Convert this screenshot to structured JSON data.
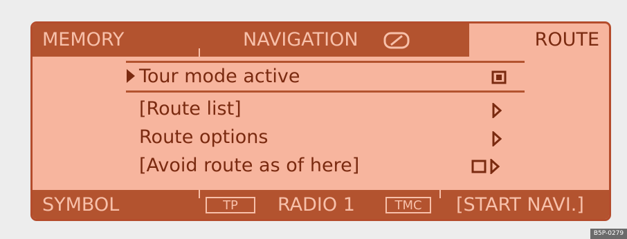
{
  "header": {
    "memory_label": "MEMORY",
    "navigation_label": "NAVIGATION",
    "route_label": "ROUTE"
  },
  "menu": {
    "items": [
      {
        "label": "Tour mode active",
        "selected": true,
        "control": "checkbox-checked"
      },
      {
        "label": "[Route list]",
        "control": "submenu-arrow"
      },
      {
        "label": "Route options",
        "control": "submenu-arrow"
      },
      {
        "label": "[Avoid route as of here]",
        "control": "checkbox-unchecked-and-arrow"
      }
    ]
  },
  "footer": {
    "symbol_label": "SYMBOL",
    "tp_label": "TP",
    "radio_label": "RADIO 1",
    "tmc_label": "TMC",
    "start_navi_label": "[START NAVI.]"
  },
  "image_code": "B5P-0279",
  "colors": {
    "screen_bg": "#f7b59e",
    "bar_bg": "#b3532f",
    "text_dark": "#7a2a10",
    "text_light": "#f7c0aa",
    "border": "#b44c2c"
  }
}
